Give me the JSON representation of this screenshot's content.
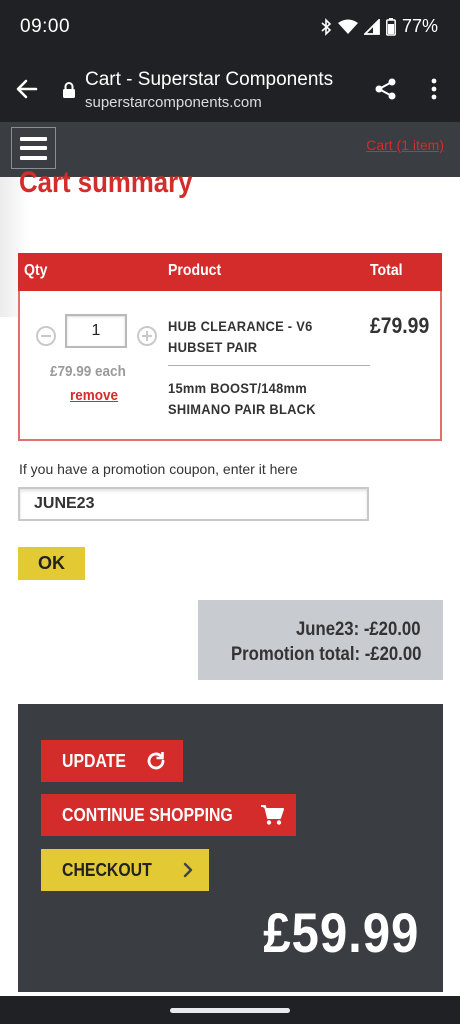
{
  "status_bar": {
    "time": "09:00",
    "battery": "77%",
    "icons": [
      "bluetooth-icon",
      "wifi-icon",
      "signal-icon",
      "battery-icon"
    ]
  },
  "browser": {
    "title": "Cart - Superstar Components",
    "url": "superstarcomponents.com",
    "icons": [
      "back-arrow-icon",
      "lock-icon",
      "share-icon",
      "more-vert-icon"
    ]
  },
  "header": {
    "menu_icon": "hamburger-icon",
    "cart_link": "Cart (1 item)"
  },
  "page": {
    "title": "Cart summary"
  },
  "cart_table": {
    "columns": [
      "Qty",
      "Product",
      "Total"
    ],
    "rows": [
      {
        "qty": "1",
        "each_price": "£79.99 each",
        "remove": "remove",
        "product_name": "HUB CLEARANCE - V6 HUBSET PAIR",
        "product_option": "15mm BOOST/148mm SHIMANO PAIR BLACK",
        "total": "£79.99"
      }
    ]
  },
  "coupon": {
    "label": "If you have a promotion coupon, enter it here",
    "value": "JUNE23",
    "ok_label": "OK"
  },
  "promotion": {
    "line1": "June23: -£20.00",
    "line2": "Promotion total: -£20.00"
  },
  "actions": {
    "update_label": "UPDATE",
    "continue_label": "CONTINUE SHOPPING",
    "checkout_label": "CHECKOUT",
    "grand_total": "£59.99"
  },
  "colors": {
    "brand_red": "#d42b2b",
    "brand_yellow": "#e3c934",
    "dark_panel": "#3a3d42",
    "promo_grey": "#c8cbd0"
  }
}
